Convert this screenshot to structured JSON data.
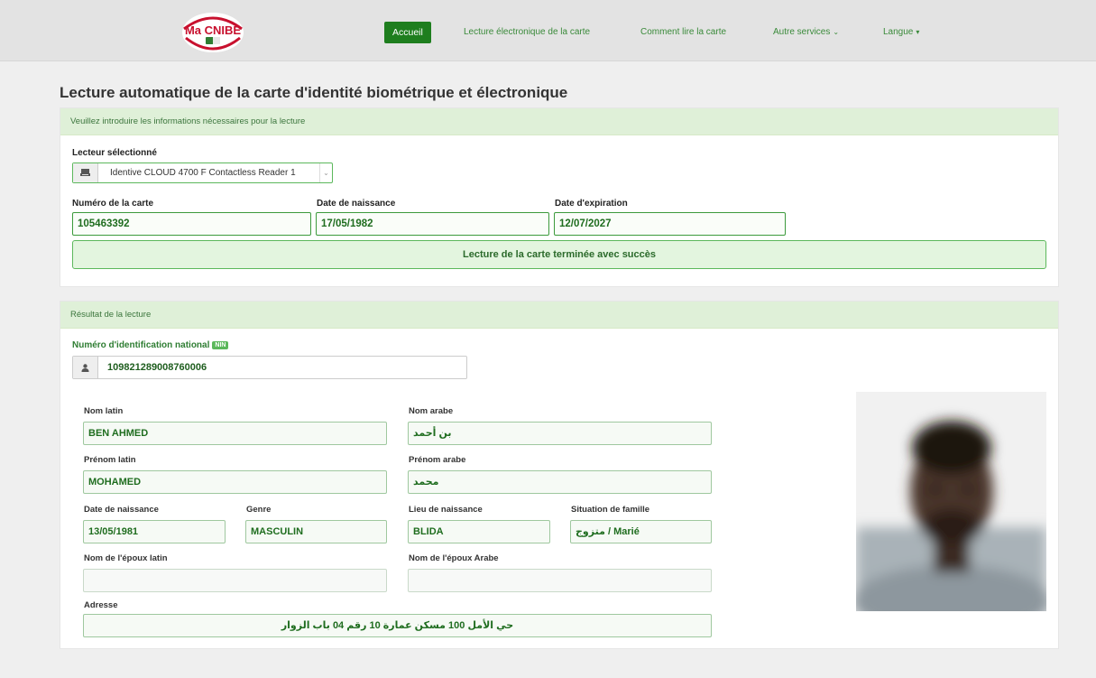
{
  "nav": {
    "logo_text": "Ma CNIBE",
    "accueil": "Accueil",
    "lecture": "Lecture électronique de la carte",
    "comment": "Comment lire la carte",
    "autres": "Autre services",
    "langue": "Langue"
  },
  "page_title": "Lecture automatique de la carte d'identité biométrique et électronique",
  "input_panel": {
    "heading": "Veuillez introduire les informations nécessaires pour la lecture",
    "reader_label": "Lecteur sélectionné",
    "reader_value": "Identive CLOUD 4700 F Contactless Reader 1",
    "card_number_label": "Numéro de la carte",
    "card_number": "105463392",
    "birth_date_label": "Date de naissance",
    "birth_date": "17/05/1982",
    "expiry_label": "Date d'expiration",
    "expiry": "12/07/2027",
    "status": "Lecture de la carte terminée avec succès"
  },
  "result_panel": {
    "heading": "Résultat de la lecture",
    "nin_label": "Numéro d'identification national",
    "nin_badge": "NIN",
    "nin_value": "109821289008760006",
    "nom_latin_label": "Nom latin",
    "nom_latin": "BEN AHMED",
    "nom_arabe_label": "Nom arabe",
    "nom_arabe": "بن أحمد",
    "prenom_latin_label": "Prénom latin",
    "prenom_latin": "MOHAMED",
    "prenom_arabe_label": "Prénom arabe",
    "prenom_arabe": "محمد",
    "date_naissance_label": "Date de naissance",
    "date_naissance": "13/05/1981",
    "genre_label": "Genre",
    "genre": "MASCULIN",
    "lieu_label": "Lieu de naissance",
    "lieu": "BLIDA",
    "situation_label": "Situation de famille",
    "situation": "متزوج / Marié",
    "epoux_latin_label": "Nom de l'époux latin",
    "epoux_latin": "",
    "epoux_arabe_label": "Nom de l'époux Arabe",
    "epoux_arabe": "",
    "adresse_label": "Adresse",
    "adresse": "حي الأمل 100 مسكن عمارة 10 رقم 04 باب الزوار"
  },
  "colors": {
    "accent": "#1e7e1e",
    "panel_heading": "#dff0d8",
    "success_bg": "#e3f5df"
  }
}
